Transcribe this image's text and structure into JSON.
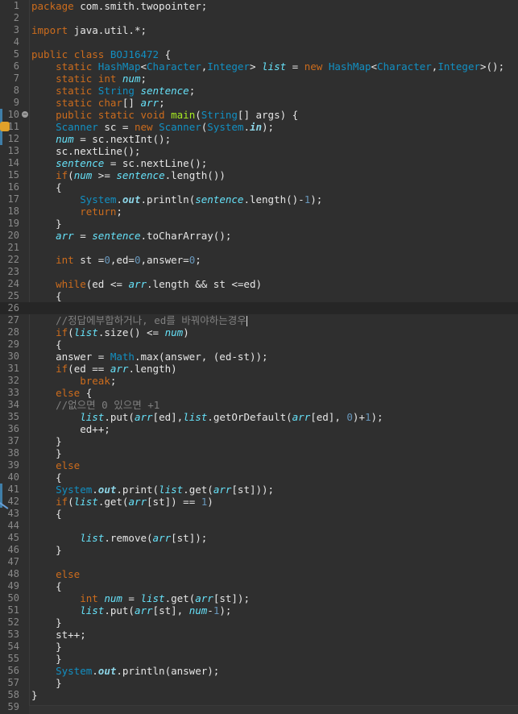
{
  "editor": {
    "lines": [
      {
        "n": "1",
        "code": "package com.smith.twopointer;"
      },
      {
        "n": "2",
        "code": ""
      },
      {
        "n": "3",
        "code": "import java.util.*;"
      },
      {
        "n": "4",
        "code": ""
      },
      {
        "n": "5",
        "code": "public class BOJ16472 {"
      },
      {
        "n": "6",
        "code": "    static HashMap<Character,Integer> list = new HashMap<Character,Integer>();"
      },
      {
        "n": "7",
        "code": "    static int num;"
      },
      {
        "n": "8",
        "code": "    static String sentence;"
      },
      {
        "n": "9",
        "code": "    static char[] arr;"
      },
      {
        "n": "10",
        "code": "    public static void main(String[] args) {"
      },
      {
        "n": "11",
        "code": "    Scanner sc = new Scanner(System.in);"
      },
      {
        "n": "12",
        "code": "    num = sc.nextInt();"
      },
      {
        "n": "13",
        "code": "    sc.nextLine();"
      },
      {
        "n": "14",
        "code": "    sentence = sc.nextLine();"
      },
      {
        "n": "15",
        "code": "    if(num >= sentence.length())"
      },
      {
        "n": "16",
        "code": "    {"
      },
      {
        "n": "17",
        "code": "        System.out.println(sentence.length()-1);"
      },
      {
        "n": "18",
        "code": "        return;"
      },
      {
        "n": "19",
        "code": "    }"
      },
      {
        "n": "20",
        "code": "    arr = sentence.toCharArray();"
      },
      {
        "n": "21",
        "code": ""
      },
      {
        "n": "22",
        "code": "    int st =0,ed=0,answer=0;"
      },
      {
        "n": "23",
        "code": ""
      },
      {
        "n": "24",
        "code": "    while(ed <= arr.length && st <=ed)"
      },
      {
        "n": "25",
        "code": "    {"
      },
      {
        "n": "26",
        "code": ""
      },
      {
        "n": "27",
        "code": "    //정답에부합하거나, ed를 바꿔야하는경우"
      },
      {
        "n": "28",
        "code": "    if(list.size() <= num)"
      },
      {
        "n": "29",
        "code": "    {"
      },
      {
        "n": "30",
        "code": "    answer = Math.max(answer, (ed-st));"
      },
      {
        "n": "31",
        "code": "    if(ed == arr.length)"
      },
      {
        "n": "32",
        "code": "        break;"
      },
      {
        "n": "33",
        "code": "    else {"
      },
      {
        "n": "34",
        "code": "    //없으면 0 있으면 +1"
      },
      {
        "n": "35",
        "code": "        list.put(arr[ed],list.getOrDefault(arr[ed], 0)+1);"
      },
      {
        "n": "36",
        "code": "        ed++;"
      },
      {
        "n": "37",
        "code": "    }"
      },
      {
        "n": "38",
        "code": "    }"
      },
      {
        "n": "39",
        "code": "    else"
      },
      {
        "n": "40",
        "code": "    {"
      },
      {
        "n": "41",
        "code": "    System.out.print(list.get(arr[st]));"
      },
      {
        "n": "42",
        "code": "    if(list.get(arr[st]) == 1)"
      },
      {
        "n": "43",
        "code": "    {"
      },
      {
        "n": "44",
        "code": ""
      },
      {
        "n": "45",
        "code": "        list.remove(arr[st]);"
      },
      {
        "n": "46",
        "code": "    }"
      },
      {
        "n": "47",
        "code": ""
      },
      {
        "n": "48",
        "code": "    else"
      },
      {
        "n": "49",
        "code": "    {"
      },
      {
        "n": "50",
        "code": "        int num = list.get(arr[st]);"
      },
      {
        "n": "51",
        "code": "        list.put(arr[st], num-1);"
      },
      {
        "n": "52",
        "code": "    }"
      },
      {
        "n": "53",
        "code": "    st++;"
      },
      {
        "n": "54",
        "code": "    }"
      },
      {
        "n": "55",
        "code": "    }"
      },
      {
        "n": "56",
        "code": "    System.out.println(answer);"
      },
      {
        "n": "57",
        "code": "    }"
      },
      {
        "n": "58",
        "code": "}"
      },
      {
        "n": "59",
        "code": ""
      }
    ],
    "current_line": "26",
    "fold_line": "10",
    "colors": {
      "background": "#2f2f2f",
      "keyword": "#cc6c1d",
      "type": "#1290c3",
      "field": "#66e1f8",
      "number": "#6897bb",
      "comment": "#808080",
      "method": "#a7ec21",
      "text": "#e6e6e6"
    }
  }
}
